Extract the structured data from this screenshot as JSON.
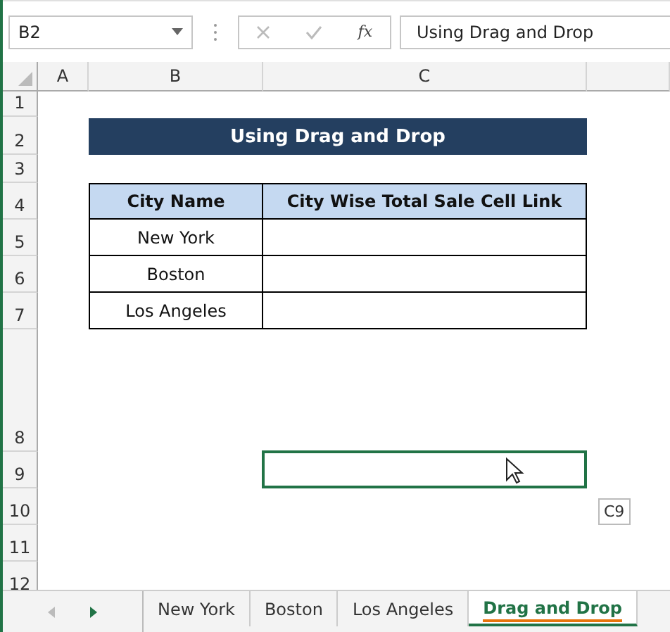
{
  "name_box": {
    "value": "B2"
  },
  "formula_bar": {
    "fx_label": "fx",
    "value": "Using Drag and Drop"
  },
  "columns": [
    "A",
    "B",
    "C"
  ],
  "row_numbers": [
    "1",
    "2",
    "3",
    "4",
    "5",
    "6",
    "7",
    "8",
    "9",
    "10",
    "11",
    "12"
  ],
  "title": "Using Drag and Drop",
  "table": {
    "columns": [
      "City Name",
      "City Wise Total Sale Cell Link"
    ],
    "rows": [
      {
        "city": "New York"
      },
      {
        "city": "Boston"
      },
      {
        "city": "Los Angeles"
      }
    ]
  },
  "drag_target": {
    "tooltip": "C9"
  },
  "sheet_tabs": [
    {
      "label": "New York",
      "selected": false
    },
    {
      "label": "Boston",
      "selected": false
    },
    {
      "label": "Los Angeles",
      "selected": false
    },
    {
      "label": "Drag and Drop",
      "selected": true
    }
  ]
}
